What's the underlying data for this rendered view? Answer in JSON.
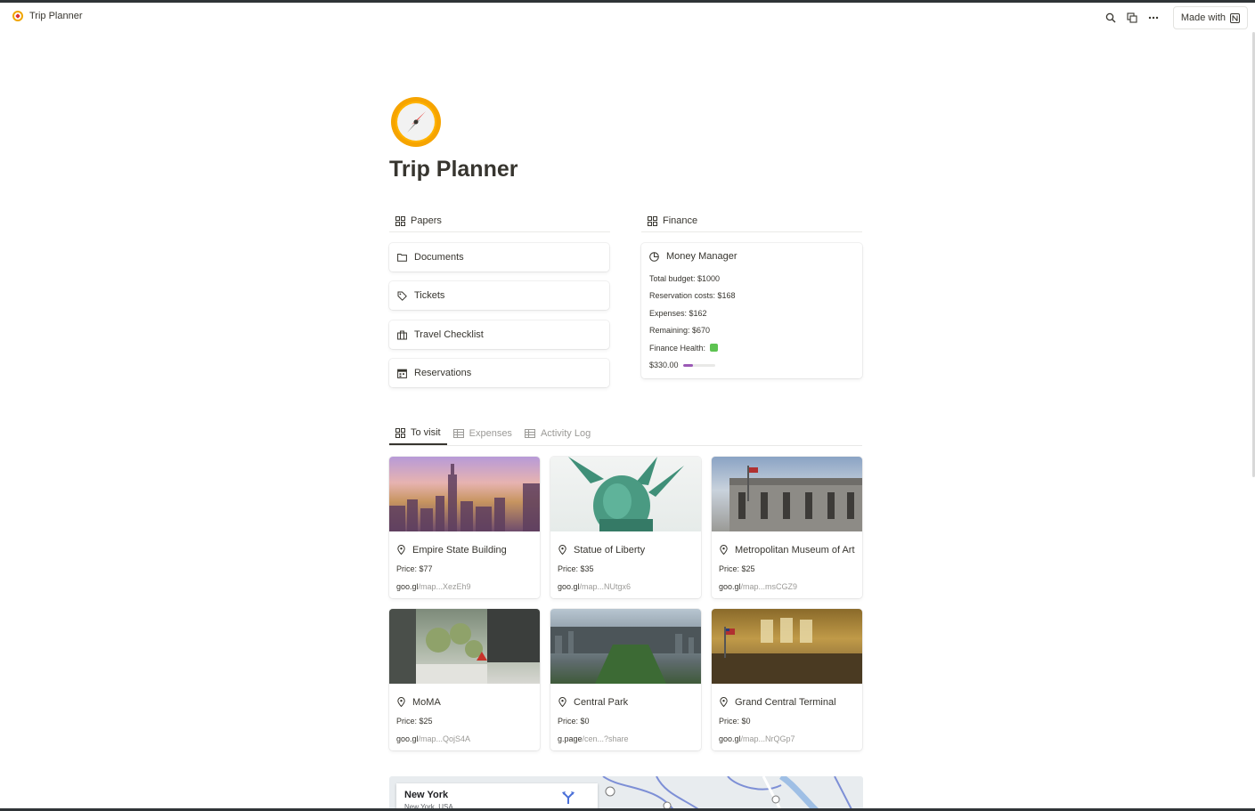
{
  "topbar": {
    "title": "Trip Planner",
    "made_with": "Made with"
  },
  "page": {
    "title": "Trip Planner",
    "icon": "compass-icon"
  },
  "papers": {
    "header": "Papers",
    "links": [
      {
        "label": "Documents",
        "icon": "folder-icon"
      },
      {
        "label": "Tickets",
        "icon": "tag-icon"
      },
      {
        "label": "Travel Checklist",
        "icon": "suitcase-icon"
      },
      {
        "label": "Reservations",
        "icon": "calendar-icon"
      }
    ]
  },
  "finance": {
    "header": "Finance",
    "money_manager": {
      "title": "Money Manager",
      "total_budget": "Total budget: $1000",
      "reservation_costs": "Reservation costs: $168",
      "expenses": "Expenses: $162",
      "remaining": "Remaining: $670",
      "finance_health": "Finance Health:",
      "health_color": "#5dc351",
      "progress_amount": "$330.00",
      "progress_fraction": 0.33
    }
  },
  "tabs": [
    {
      "label": "To visit",
      "active": true
    },
    {
      "label": "Expenses",
      "active": false
    },
    {
      "label": "Activity Log",
      "active": false
    }
  ],
  "places": [
    {
      "name": "Empire State Building",
      "price": "Price: $77",
      "domain": "goo.gl",
      "path": "/map...XezEh9"
    },
    {
      "name": "Statue of Liberty",
      "price": "Price: $35",
      "domain": "goo.gl",
      "path": "/map...NUtgx6"
    },
    {
      "name": "Metropolitan Museum of Art",
      "price": "Price: $25",
      "domain": "goo.gl",
      "path": "/map...msCGZ9"
    },
    {
      "name": "MoMA",
      "price": "Price: $25",
      "domain": "goo.gl",
      "path": "/map...QojS4A"
    },
    {
      "name": "Central Park",
      "price": "Price: $0",
      "domain": "g.page",
      "path": "/cen...?share"
    },
    {
      "name": "Grand Central Terminal",
      "price": "Price: $0",
      "domain": "goo.gl",
      "path": "/map...NrQGp7"
    }
  ],
  "map": {
    "city": "New York",
    "subtitle": "New York, USA"
  }
}
